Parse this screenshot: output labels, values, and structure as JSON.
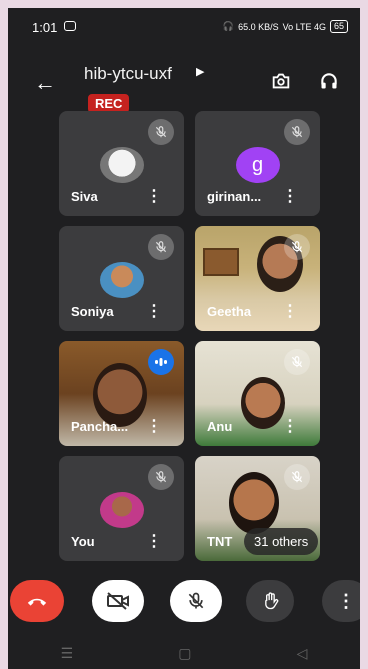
{
  "status_bar": {
    "time": "1:01",
    "speed": "65.0 KB/S",
    "network": "Vo LTE 4G",
    "battery": "65"
  },
  "meeting": {
    "code": "hib-ytcu-uxf",
    "rec_label": "REC"
  },
  "participants": [
    {
      "name": "Siva",
      "muted": true
    },
    {
      "name": "girinan...",
      "muted": true,
      "initial": "g",
      "avatar_color": "#a142f4"
    },
    {
      "name": "Soniya",
      "muted": true
    },
    {
      "name": "Geetha",
      "muted": true
    },
    {
      "name": "Pancha...",
      "speaking": true
    },
    {
      "name": "Anu",
      "muted": true
    },
    {
      "name": "You",
      "muted": true
    },
    {
      "name": "TNT",
      "muted": true
    }
  ],
  "others_label": "31 others",
  "colors": {
    "end_call": "#ea4335",
    "background": "#1f1f21",
    "tile": "#3c3c3e"
  }
}
